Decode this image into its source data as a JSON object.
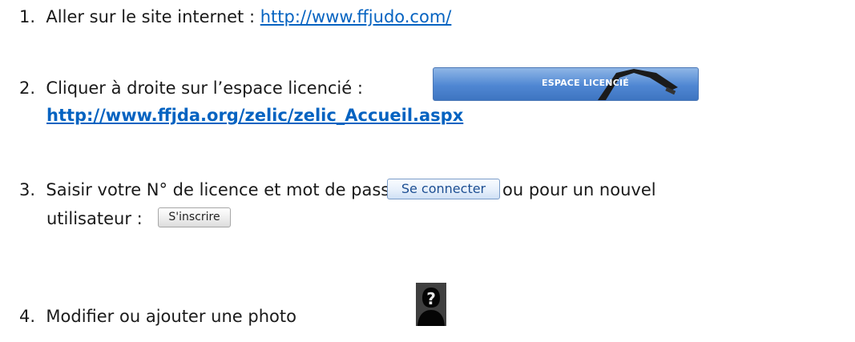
{
  "steps": {
    "s1": {
      "number": "1.",
      "text": "Aller sur le site internet : ",
      "link": "http://www.ffjudo.com/"
    },
    "s2": {
      "number": "2.",
      "text": "Cliquer à droite sur l’espace licencié :",
      "banner_label": "ESPACE LICENCIÉ",
      "link": "http://www.ffjda.org/zelic/zelic_Accueil.aspx"
    },
    "s3": {
      "number": "3.",
      "text_before": "Saisir votre N° de licence et mot de passe et",
      "connect_label": "Se connecter",
      "text_after": "ou pour un nouvel",
      "text_line2": "utilisateur :",
      "register_label": "S'inscrire"
    },
    "s4": {
      "number": "4.",
      "text": "Modifier ou ajouter une photo",
      "photo_icon": "unknown-user-photo-icon"
    }
  },
  "colors": {
    "link": "#0563c1",
    "banner": "#4f87d3",
    "button_text": "#1d4f93"
  }
}
